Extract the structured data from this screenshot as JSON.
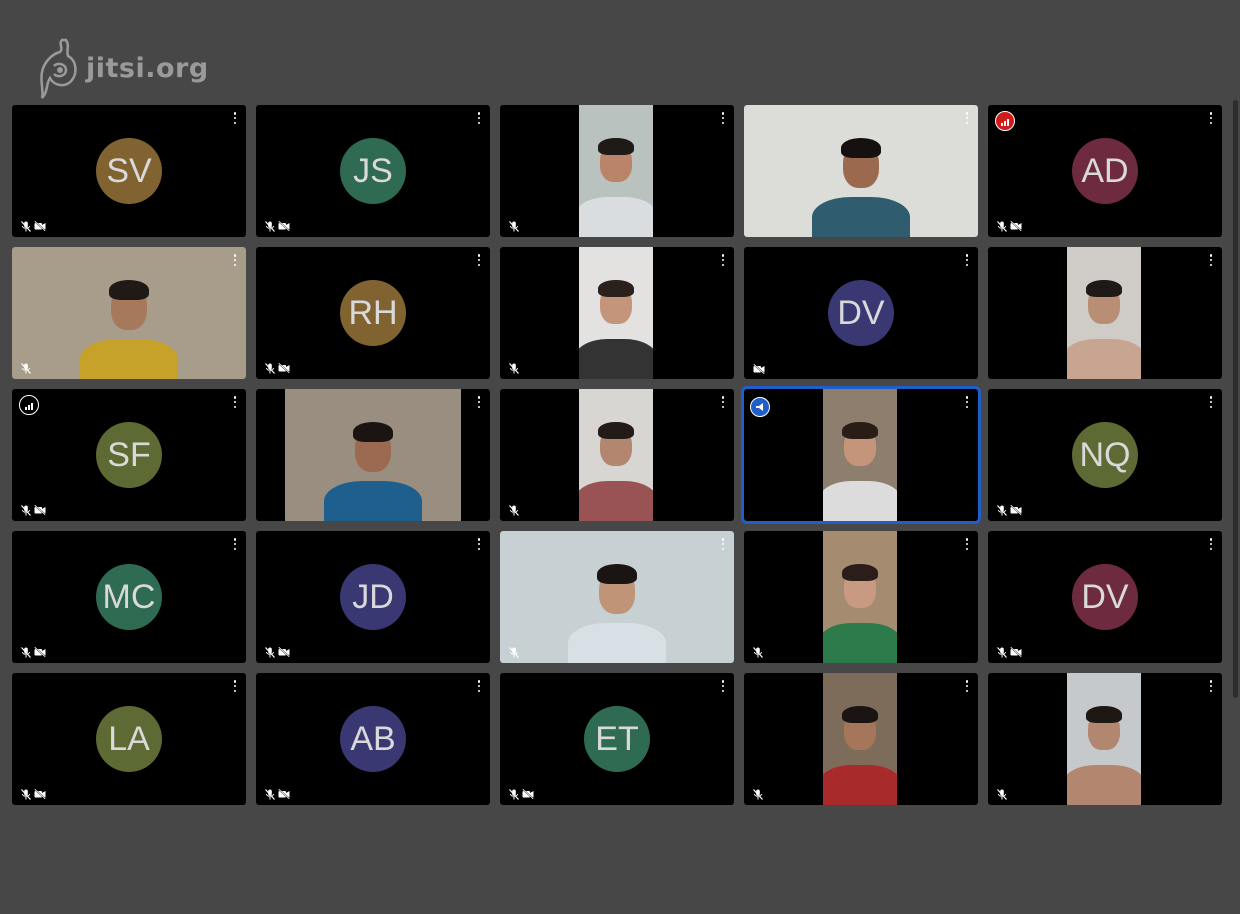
{
  "logo": {
    "text": "jitsi.org",
    "icon": "jitsi-logo-icon"
  },
  "colors": {
    "background": "#474747",
    "tile": "#000000",
    "active_border": "#1f5ecb",
    "connection_poor": "#d11a1a",
    "menu_dots": "#ffffff"
  },
  "tiles": [
    {
      "type": "avatar",
      "initials": "SV",
      "color": "#806331",
      "audio_muted": true,
      "video_muted": true
    },
    {
      "type": "avatar",
      "initials": "JS",
      "color": "#2f6a52",
      "audio_muted": true,
      "video_muted": true
    },
    {
      "type": "video",
      "variant": "narrow",
      "palette": "a",
      "audio_muted": true,
      "video_muted": false
    },
    {
      "type": "video",
      "variant": "wide",
      "palette": "b",
      "audio_muted": false,
      "video_muted": false
    },
    {
      "type": "avatar",
      "initials": "AD",
      "color": "#6e2b40",
      "audio_muted": true,
      "video_muted": true,
      "connection_indicator": "poor"
    },
    {
      "type": "video",
      "variant": "wide",
      "palette": "c",
      "audio_muted": true,
      "video_muted": false
    },
    {
      "type": "avatar",
      "initials": "RH",
      "color": "#806331",
      "audio_muted": true,
      "video_muted": true
    },
    {
      "type": "video",
      "variant": "narrow",
      "palette": "d",
      "audio_muted": true,
      "video_muted": false
    },
    {
      "type": "avatar",
      "initials": "DV",
      "color": "#3a3873",
      "audio_muted": false,
      "video_muted": true
    },
    {
      "type": "video",
      "variant": "narrow",
      "palette": "e",
      "audio_muted": false,
      "video_muted": false
    },
    {
      "type": "avatar",
      "initials": "SF",
      "color": "#5d6a33",
      "audio_muted": true,
      "video_muted": true,
      "connection_indicator": "neutral"
    },
    {
      "type": "video",
      "variant": "mid",
      "palette": "f",
      "audio_muted": false,
      "video_muted": false
    },
    {
      "type": "video",
      "variant": "narrow",
      "palette": "g",
      "audio_muted": true,
      "video_muted": false
    },
    {
      "type": "video",
      "variant": "narrow",
      "palette": "h",
      "audio_muted": false,
      "video_muted": false,
      "active": true,
      "dominant_speaker_icon": true
    },
    {
      "type": "avatar",
      "initials": "NQ",
      "color": "#5d6a33",
      "audio_muted": true,
      "video_muted": true
    },
    {
      "type": "avatar",
      "initials": "MC",
      "color": "#2f6a52",
      "audio_muted": true,
      "video_muted": true
    },
    {
      "type": "avatar",
      "initials": "JD",
      "color": "#3a3873",
      "audio_muted": true,
      "video_muted": true
    },
    {
      "type": "video",
      "variant": "wide",
      "palette": "i",
      "audio_muted": true,
      "video_muted": false
    },
    {
      "type": "video",
      "variant": "narrow",
      "palette": "j",
      "audio_muted": true,
      "video_muted": false
    },
    {
      "type": "avatar",
      "initials": "DV",
      "color": "#6e2b40",
      "audio_muted": true,
      "video_muted": true
    },
    {
      "type": "avatar",
      "initials": "LA",
      "color": "#5d6a33",
      "audio_muted": true,
      "video_muted": true
    },
    {
      "type": "avatar",
      "initials": "AB",
      "color": "#3a3873",
      "audio_muted": true,
      "video_muted": true
    },
    {
      "type": "avatar",
      "initials": "ET",
      "color": "#2f6a52",
      "audio_muted": true,
      "video_muted": true
    },
    {
      "type": "video",
      "variant": "narrow",
      "palette": "k",
      "audio_muted": true,
      "video_muted": false
    },
    {
      "type": "video",
      "variant": "narrow",
      "palette": "l",
      "audio_muted": true,
      "video_muted": false
    }
  ]
}
